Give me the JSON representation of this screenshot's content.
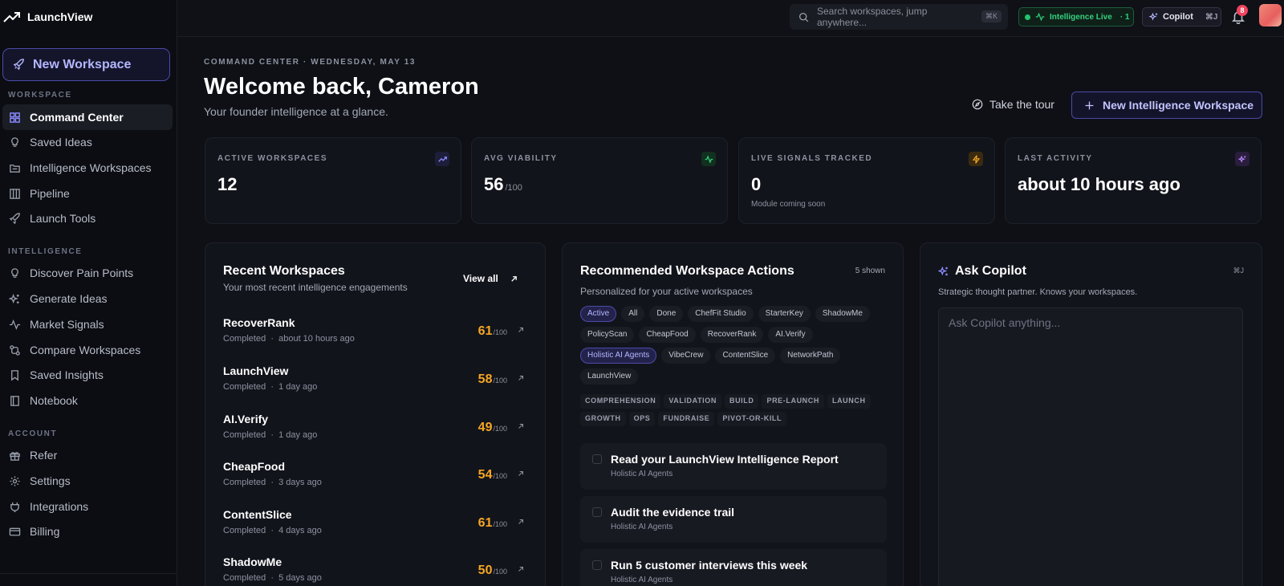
{
  "app": {
    "name": "LaunchView"
  },
  "sidebar": {
    "new_workspace": "New Workspace",
    "sections": {
      "workspace": "WORKSPACE",
      "intelligence": "INTELLIGENCE",
      "account": "ACCOUNT"
    },
    "items": [
      {
        "label": "Command Center",
        "icon": "grid-icon",
        "active": true
      },
      {
        "label": "Saved Ideas",
        "icon": "lightbulb-icon"
      },
      {
        "label": "Intelligence Workspaces",
        "icon": "folder-icon"
      },
      {
        "label": "Pipeline",
        "icon": "columns-icon"
      },
      {
        "label": "Launch Tools",
        "icon": "rocket-icon"
      },
      {
        "label": "Discover Pain Points",
        "icon": "lightbulb-icon"
      },
      {
        "label": "Generate Ideas",
        "icon": "sparkles-icon"
      },
      {
        "label": "Market Signals",
        "icon": "activity-icon"
      },
      {
        "label": "Compare Workspaces",
        "icon": "compare-icon"
      },
      {
        "label": "Saved Insights",
        "icon": "bookmark-icon"
      },
      {
        "label": "Notebook",
        "icon": "notebook-icon"
      },
      {
        "label": "Refer",
        "icon": "gift-icon"
      },
      {
        "label": "Settings",
        "icon": "gear-icon"
      },
      {
        "label": "Integrations",
        "icon": "plug-icon"
      },
      {
        "label": "Billing",
        "icon": "card-icon"
      }
    ]
  },
  "topbar": {
    "search_placeholder": "Search workspaces, jump anywhere...",
    "search_kbd": "⌘K",
    "live_label": "Intelligence Live",
    "live_count": "· 1",
    "copilot_label": "Copilot",
    "copilot_kbd": "⌘J",
    "notifications": "8"
  },
  "header": {
    "eyebrow": "COMMAND CENTER · WEDNESDAY, MAY 13",
    "title": "Welcome back, Cameron",
    "subtitle": "Your founder intelligence at a glance.",
    "tour": "Take the tour",
    "primary": "New Intelligence Workspace"
  },
  "stats": [
    {
      "label": "ACTIVE WORKSPACES",
      "value": "12",
      "unit": "",
      "note": ""
    },
    {
      "label": "AVG VIABILITY",
      "value": "56",
      "unit": "/100",
      "note": ""
    },
    {
      "label": "LIVE SIGNALS TRACKED",
      "value": "0",
      "unit": "",
      "note": "Module coming soon"
    },
    {
      "label": "LAST ACTIVITY",
      "value": "about 10 hours ago",
      "unit": "",
      "note": ""
    }
  ],
  "recent": {
    "title": "Recent Workspaces",
    "subtitle": "Your most recent intelligence engagements",
    "view_all": "View all",
    "items": [
      {
        "name": "RecoverRank",
        "status": "Completed",
        "time": "about 10 hours ago",
        "score": "61",
        "max": "/100"
      },
      {
        "name": "LaunchView",
        "status": "Completed",
        "time": "1 day ago",
        "score": "58",
        "max": "/100"
      },
      {
        "name": "AI.Verify",
        "status": "Completed",
        "time": "1 day ago",
        "score": "49",
        "max": "/100"
      },
      {
        "name": "CheapFood",
        "status": "Completed",
        "time": "3 days ago",
        "score": "54",
        "max": "/100"
      },
      {
        "name": "ContentSlice",
        "status": "Completed",
        "time": "4 days ago",
        "score": "61",
        "max": "/100"
      },
      {
        "name": "ShadowMe",
        "status": "Completed",
        "time": "5 days ago",
        "score": "50",
        "max": "/100"
      }
    ]
  },
  "actions": {
    "title": "Recommended Workspace Actions",
    "count": "5 shown",
    "subtitle": "Personalized for your active workspaces",
    "filters": [
      {
        "label": "Active",
        "active": true
      },
      {
        "label": "All"
      },
      {
        "label": "Done"
      },
      {
        "label": "ChefFit Studio"
      },
      {
        "label": "StarterKey"
      },
      {
        "label": "ShadowMe"
      },
      {
        "label": "PolicyScan"
      },
      {
        "label": "CheapFood"
      },
      {
        "label": "RecoverRank"
      },
      {
        "label": "AI.Verify"
      },
      {
        "label": "Holistic AI Agents",
        "active": true
      },
      {
        "label": "VibeCrew"
      },
      {
        "label": "ContentSlice"
      },
      {
        "label": "NetworkPath"
      },
      {
        "label": "LaunchView"
      }
    ],
    "stages": [
      "COMPREHENSION",
      "VALIDATION",
      "BUILD",
      "PRE-LAUNCH",
      "LAUNCH",
      "GROWTH",
      "OPS",
      "FUNDRAISE",
      "PIVOT-OR-KILL"
    ],
    "tasks": [
      {
        "title": "Read your LaunchView Intelligence Report",
        "workspace": "Holistic AI Agents"
      },
      {
        "title": "Audit the evidence trail",
        "workspace": "Holistic AI Agents"
      },
      {
        "title": "Run 5 customer interviews this week",
        "workspace": "Holistic AI Agents"
      }
    ]
  },
  "copilot": {
    "title": "Ask Copilot",
    "kbd": "⌘J",
    "subtitle": "Strategic thought partner. Knows your workspaces.",
    "placeholder": "Ask Copilot anything..."
  }
}
